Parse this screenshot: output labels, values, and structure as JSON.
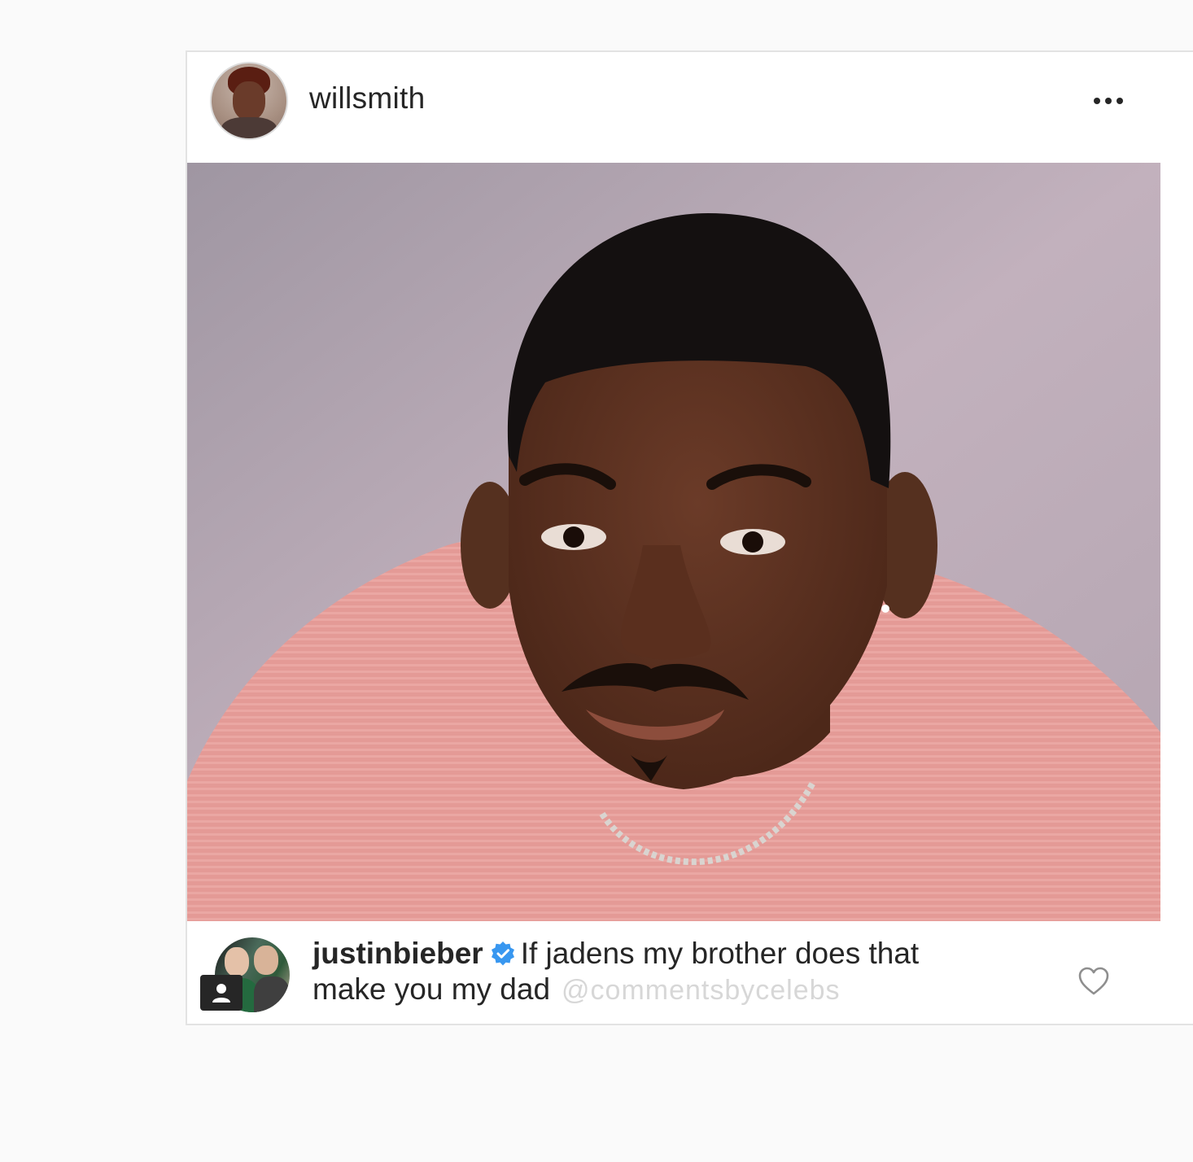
{
  "post": {
    "author": {
      "username": "willsmith",
      "avatar_icon": "profile-photo-avatar"
    },
    "header_menu_icon": "more-options-icon",
    "photo": {
      "background_color": "#b9a9b5",
      "sweater_color": "#e59b98"
    },
    "comment": {
      "username": "justinbieber",
      "verified": true,
      "verified_color": "#3897f0",
      "text_line1": "If jadens my brother does that",
      "text_line2": "make you my dad",
      "watermark": "@commentsbycelebs",
      "like_icon": "heart-icon",
      "tag_icon": "user-tag-icon"
    }
  }
}
